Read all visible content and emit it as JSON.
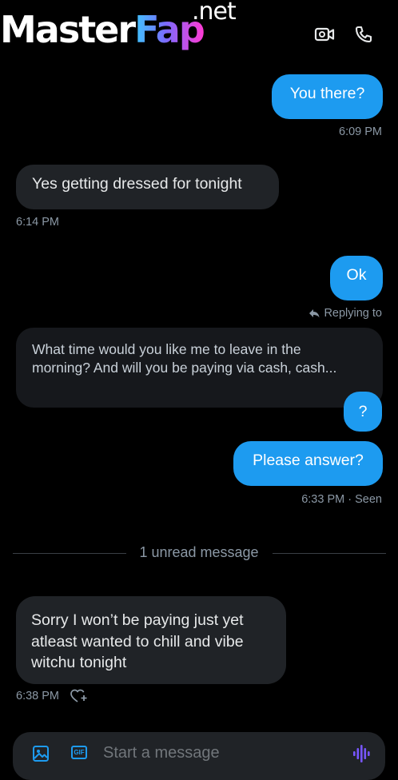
{
  "watermark": {
    "part1": "Master",
    "part2": "Fap",
    "suffix": ".net"
  },
  "header": {
    "icons": [
      "video-call-icon",
      "phone-icon"
    ]
  },
  "messages": [
    {
      "dir": "out",
      "text": "You there?",
      "time": "6:09 PM"
    },
    {
      "dir": "in",
      "text": "Yes getting dressed for tonight",
      "time": "6:14 PM"
    },
    {
      "dir": "out",
      "text": "Ok"
    },
    {
      "dir": "out",
      "reply_label": "Replying to",
      "quoted_line1": "What time would you like me to leave in the",
      "quoted_line2": "morning? And will you be paying via cash, cash...",
      "text": "?"
    },
    {
      "dir": "out",
      "text": "Please answer?",
      "time": "6:33 PM",
      "separator": "·",
      "status": "Seen"
    },
    {
      "dir": "in",
      "line1": "Sorry I won’t be paying just yet",
      "line2": "atleast  wanted to chill and vibe",
      "line3": "witchu tonight",
      "time": "6:38 PM"
    }
  ],
  "unread_divider": "1 unread message",
  "composer": {
    "gif_label": "GIF",
    "placeholder": "Start a message"
  },
  "colors": {
    "accent": "#1d9bf0",
    "incoming_bubble": "#202327",
    "background": "#000000",
    "voice_icon": "#7856ff"
  }
}
